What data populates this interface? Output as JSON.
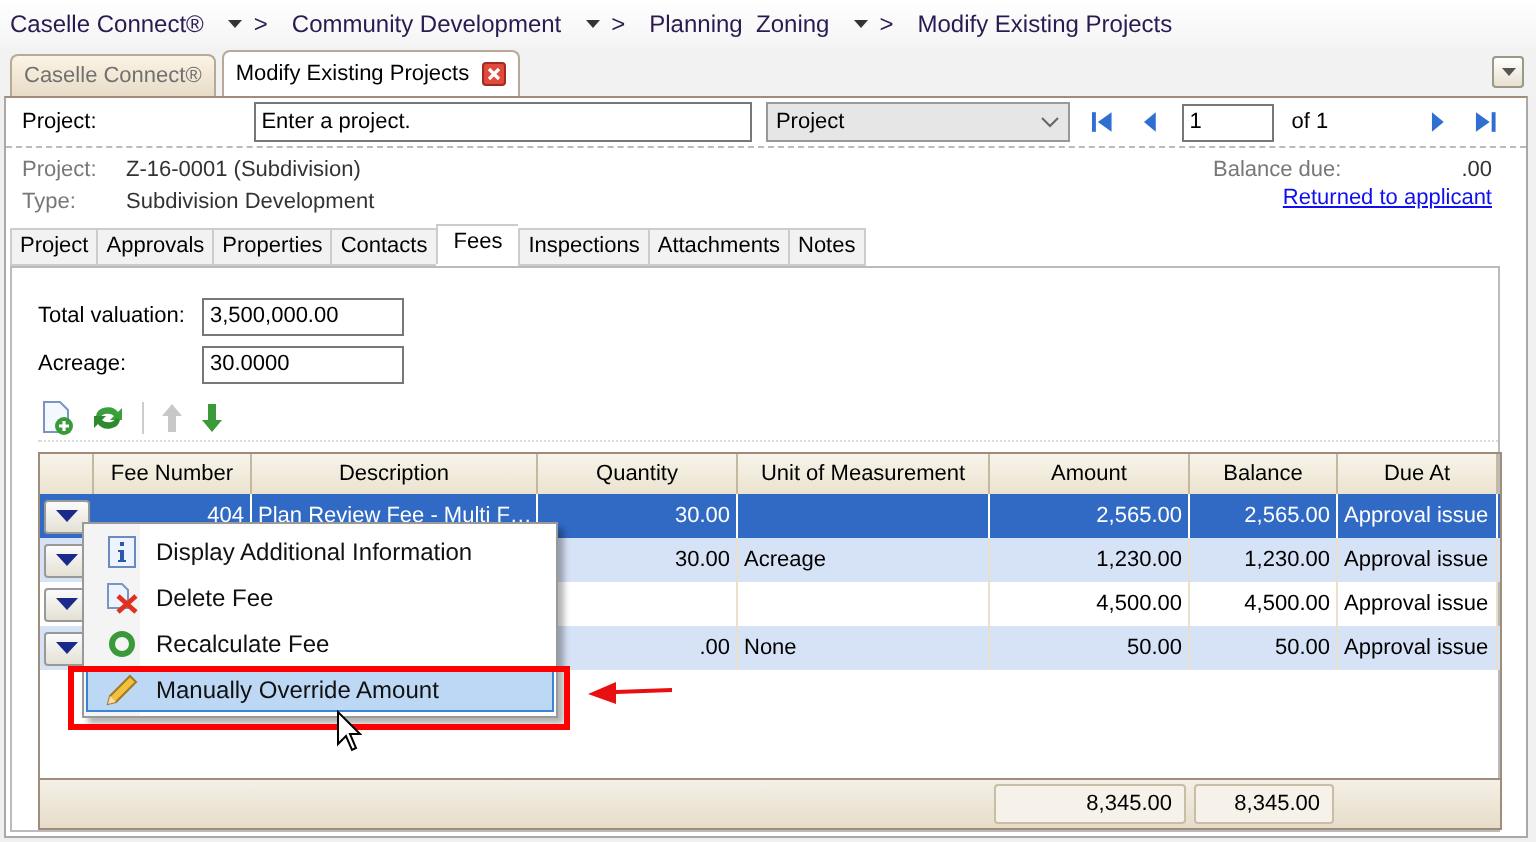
{
  "breadcrumb": [
    {
      "label": "Caselle Connect®",
      "separator": ">"
    },
    {
      "label": "Community Development",
      "separator": ">"
    },
    {
      "label": "Planning  Zoning",
      "separator": ">"
    },
    {
      "label": "Modify Existing Projects"
    }
  ],
  "tabs": [
    {
      "label": "Caselle Connect®",
      "selected": false
    },
    {
      "label": "Modify Existing Projects",
      "selected": true
    }
  ],
  "search": {
    "label": "Project:",
    "placeholder": "Enter a project.",
    "type": "Project",
    "page": "1",
    "of": "of 1"
  },
  "info": {
    "project_label": "Project:",
    "project": "Z-16-0001 (Subdivision)",
    "type_label": "Type:",
    "type": "Subdivision Development",
    "balance_label": "Balance due:",
    "balance": ".00",
    "status_link": "Returned to applicant"
  },
  "detail_tabs": [
    {
      "label": "Project",
      "selected": false
    },
    {
      "label": "Approvals",
      "selected": false
    },
    {
      "label": "Properties",
      "selected": false
    },
    {
      "label": "Contacts",
      "selected": false
    },
    {
      "label": "Fees",
      "selected": true
    },
    {
      "label": "Inspections",
      "selected": false
    },
    {
      "label": "Attachments",
      "selected": false
    },
    {
      "label": "Notes",
      "selected": false
    }
  ],
  "fields": [
    {
      "label": "Total valuation:",
      "value": "3,500,000.00"
    },
    {
      "label": "Acreage:",
      "value": "30.0000"
    }
  ],
  "toolbar": [
    {
      "kind": "add",
      "disabled": false
    },
    {
      "kind": "recalc",
      "disabled": false
    },
    {
      "kind": "up",
      "disabled": true
    },
    {
      "kind": "down",
      "disabled": false
    }
  ],
  "table": {
    "columns": [
      "Fee Number",
      "Description",
      "Quantity",
      "Unit of Measurement",
      "Amount",
      "Balance",
      "Due At"
    ],
    "rows": [
      {
        "selected": true,
        "cells": [
          "404",
          "Plan Review Fee - Multi F…",
          "30.00",
          "",
          "2,565.00",
          "2,565.00",
          "Approval issue"
        ]
      },
      {
        "selected": false,
        "cells": [
          "",
          "",
          "30.00",
          "Acreage",
          "1,230.00",
          "1,230.00",
          "Approval issue"
        ]
      },
      {
        "selected": false,
        "cells": [
          "",
          "",
          "",
          "",
          "4,500.00",
          "4,500.00",
          "Approval issue"
        ]
      },
      {
        "selected": false,
        "cells": [
          "",
          "",
          ".00",
          "None",
          "50.00",
          "50.00",
          "Approval issue"
        ]
      }
    ],
    "totals": [
      "8,345.00",
      "8,345.00"
    ]
  },
  "context_menu": [
    {
      "kind": "info",
      "label": "Display Additional Information",
      "highlighted": false
    },
    {
      "kind": "delete",
      "label": "Delete Fee",
      "highlighted": false
    },
    {
      "kind": "recalc",
      "label": "Recalculate Fee",
      "highlighted": false
    },
    {
      "kind": "edit",
      "label": "Manually Override Amount",
      "highlighted": true
    }
  ]
}
